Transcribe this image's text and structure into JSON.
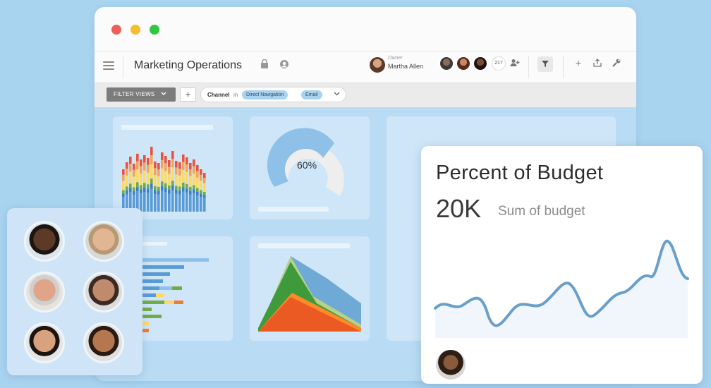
{
  "window": {
    "title": "Marketing Operations",
    "owner_label": "Owner",
    "owner_name": "Martha Allen",
    "member_count": "217"
  },
  "filterbar": {
    "filter_views_label": "FILTER VIEWS",
    "add_label": "+",
    "chip_key": "Channel",
    "chip_op": "in",
    "chips": [
      "Direct Navigation",
      "Email"
    ]
  },
  "gauge": {
    "label": "60%",
    "value": 0.6
  },
  "budget": {
    "title": "Percent of Budget",
    "value": "20K",
    "sub": "Sum of budget"
  },
  "colors": {
    "blue": "#5b9bd5",
    "orange": "#ed7d31",
    "green": "#70ad47",
    "yellow": "#ffd966",
    "red": "#e8533f",
    "line": "#6a9fc9"
  },
  "icons": [
    "menu-icon",
    "lock-icon",
    "eye-icon",
    "add-person-icon",
    "filter-icon",
    "plus-icon",
    "share-icon",
    "wrench-icon",
    "chevron-down-icon"
  ]
}
